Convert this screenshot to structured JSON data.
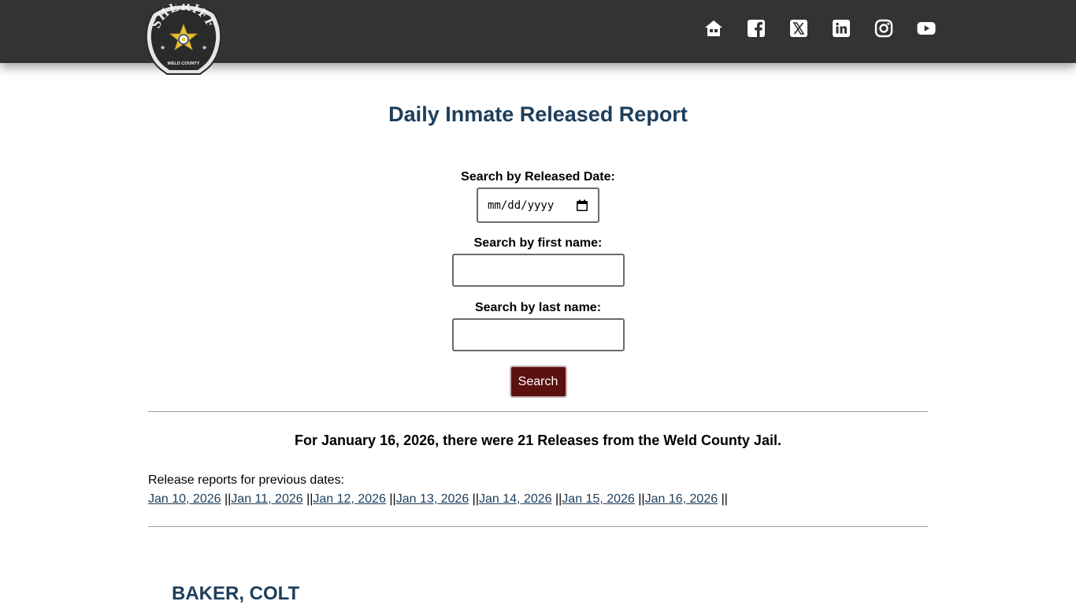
{
  "header": {
    "logo": {
      "top_text": "SHERIFF",
      "bottom_text": "WELD COUNTY"
    },
    "social_links": [
      {
        "icon": "home-icon"
      },
      {
        "icon": "facebook-icon"
      },
      {
        "icon": "x-icon"
      },
      {
        "icon": "linkedin-icon"
      },
      {
        "icon": "instagram-icon"
      },
      {
        "icon": "youtube-icon"
      }
    ]
  },
  "page": {
    "title": "Daily Inmate Released Report"
  },
  "search": {
    "date_label": "Search by Released Date:",
    "date_value": "mm/dd/yyyy",
    "first_name_label": "Search by first name:",
    "first_name_value": "",
    "last_name_label": "Search by last name:",
    "last_name_value": "",
    "button_label": "Search"
  },
  "summary": {
    "text": "For January 16, 2026, there were 21 Releases from the Weld County Jail."
  },
  "previous": {
    "label": "Release reports for previous dates:",
    "separator": " ||",
    "dates": [
      "Jan 10, 2026",
      "Jan 11, 2026",
      "Jan 12, 2026",
      "Jan 13, 2026",
      "Jan 14, 2026",
      "Jan 15, 2026",
      "Jan 16, 2026"
    ]
  },
  "records": [
    {
      "name": "BAKER, COLT"
    }
  ],
  "colors": {
    "header_bg": "#333333",
    "title": "#1d3e5b",
    "button_bg": "#5c1111",
    "link": "#1d3e5b"
  }
}
